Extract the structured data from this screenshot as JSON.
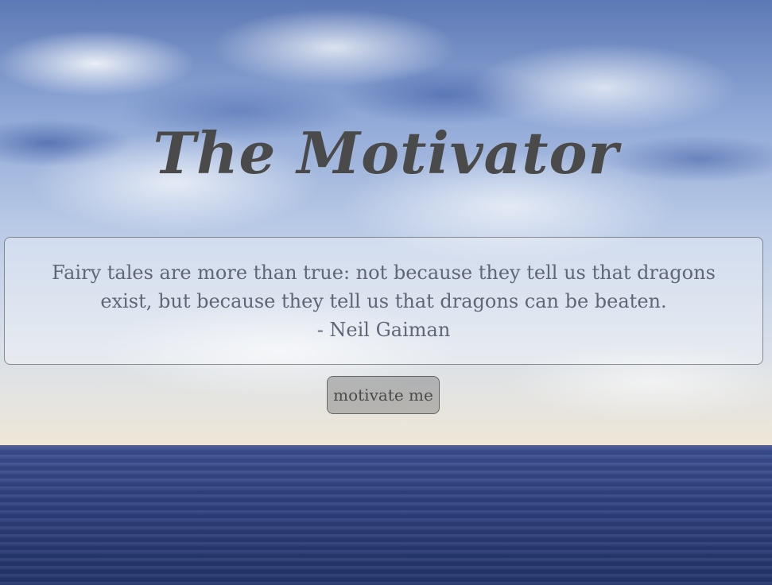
{
  "app": {
    "title": "The Motivator"
  },
  "quote": {
    "text": "Fairy tales are more than true: not because they tell us that dragons exist, but because they tell us that dragons can be beaten.",
    "author": "- Neil Gaiman"
  },
  "actions": {
    "motivate_label": "motivate me"
  },
  "colors": {
    "title": "#4a4a4a",
    "quote_text": "#5f6777",
    "button_bg": "#787878",
    "box_border": "#3c3c3c"
  }
}
